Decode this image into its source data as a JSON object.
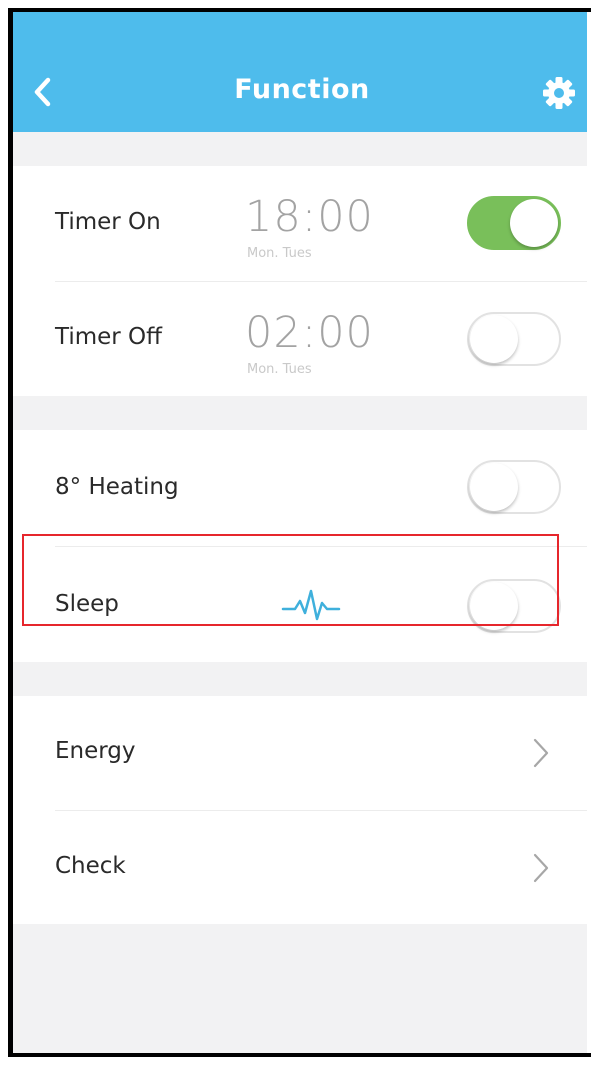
{
  "header": {
    "title": "Function",
    "back_icon": "chevron-left-icon",
    "settings_icon": "gear-icon"
  },
  "colors": {
    "header_bg": "#4ebcec",
    "toggle_on": "#79bf5a",
    "highlight": "#e6262c",
    "pulse": "#3fb0dc"
  },
  "timers": [
    {
      "label": "Timer On",
      "time": "18:00",
      "days": "Mon. Tues",
      "enabled": true
    },
    {
      "label": "Timer Off",
      "time": "02:00",
      "days": "Mon. Tues",
      "enabled": false
    }
  ],
  "modes": [
    {
      "label": "8° Heating",
      "enabled": false
    },
    {
      "label": "Sleep",
      "enabled": false,
      "icon": "sleep-pulse-icon",
      "highlighted": true
    }
  ],
  "links": [
    {
      "label": "Energy",
      "icon": "chevron-right-icon"
    },
    {
      "label": "Check",
      "icon": "chevron-right-icon"
    }
  ]
}
